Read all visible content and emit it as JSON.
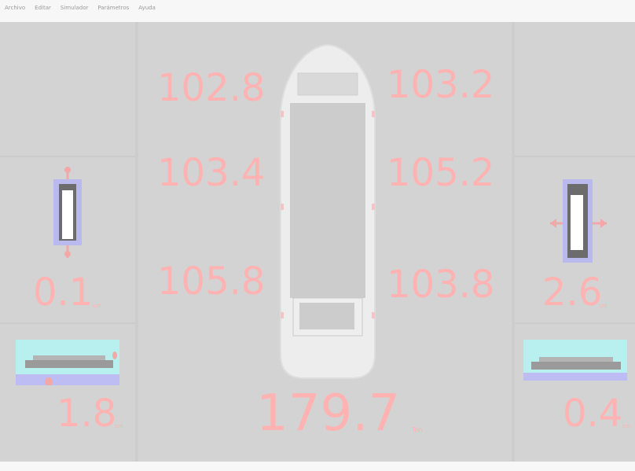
{
  "menu": [
    "Archivo",
    "Editar",
    "Simulador",
    "Parámetros",
    "Ayuda"
  ],
  "drafts": {
    "fore_port": "102.8",
    "fore_stbd": "103.2",
    "mid_port": "103.4",
    "mid_stbd": "105.2",
    "aft_port": "105.8",
    "aft_stbd": "103.8"
  },
  "left": {
    "list_value": "0.1",
    "list_unit": "cm",
    "trim_value": "1.8",
    "trim_unit": "cm"
  },
  "right": {
    "list_value": "2.6",
    "list_unit": "cm",
    "trim_value": "0.4",
    "trim_unit": "cm"
  },
  "displacement": {
    "value": "179.7",
    "unit": "Ton"
  },
  "colors": {
    "value_text": "#ffb2b2",
    "panel_bg": "#d3d3d3",
    "indicator": "#b9b9ee",
    "water": "#b8efef"
  }
}
